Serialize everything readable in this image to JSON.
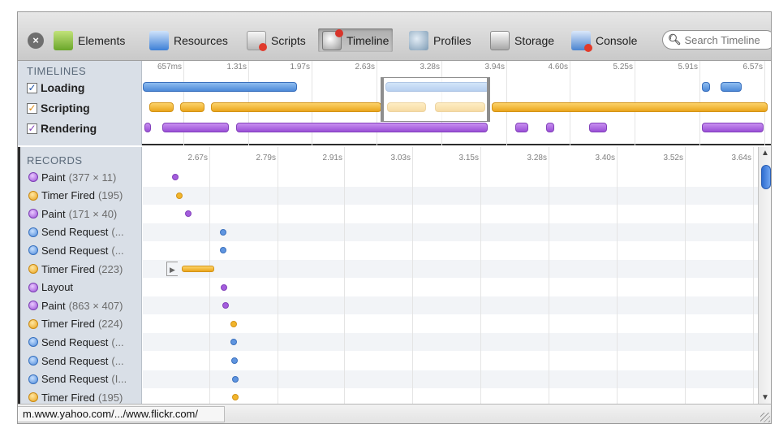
{
  "toolbar": {
    "tabs": [
      {
        "label": "Elements",
        "icon": "elements-icon"
      },
      {
        "label": "Resources",
        "icon": "resources-icon"
      },
      {
        "label": "Scripts",
        "icon": "scripts-icon"
      },
      {
        "label": "Timeline",
        "icon": "timeline-icon",
        "active": true
      },
      {
        "label": "Profiles",
        "icon": "profiles-icon"
      },
      {
        "label": "Storage",
        "icon": "storage-icon"
      },
      {
        "label": "Console",
        "icon": "console-icon"
      }
    ],
    "search_placeholder": "Search Timeline"
  },
  "timelines": {
    "header": "TIMELINES",
    "ticks": [
      "657ms",
      "1.31s",
      "1.97s",
      "2.63s",
      "3.28s",
      "3.94s",
      "4.60s",
      "5.25s",
      "5.91s",
      "6.57s"
    ],
    "categories": [
      {
        "label": "Loading",
        "checked": true,
        "color": "#4d89d8"
      },
      {
        "label": "Scripting",
        "checked": true,
        "color": "#eaa51c"
      },
      {
        "label": "Rendering",
        "checked": true,
        "color": "#9a4fd6"
      }
    ]
  },
  "records": {
    "header": "RECORDS",
    "ticks": [
      "2.67s",
      "2.79s",
      "2.91s",
      "3.03s",
      "3.15s",
      "3.28s",
      "3.40s",
      "3.52s",
      "3.64s"
    ],
    "rows": [
      {
        "type": "Paint",
        "detail": "(377 × 11)",
        "color": "purple"
      },
      {
        "type": "Timer Fired",
        "detail": "(195)",
        "color": "yellow"
      },
      {
        "type": "Paint",
        "detail": "(171 × 40)",
        "color": "purple"
      },
      {
        "type": "Send Request",
        "detail": "(...",
        "color": "blue"
      },
      {
        "type": "Send Request",
        "detail": "(...",
        "color": "blue"
      },
      {
        "type": "Timer Fired",
        "detail": "(223)",
        "color": "yellow"
      },
      {
        "type": "Layout",
        "detail": "",
        "color": "purple"
      },
      {
        "type": "Paint",
        "detail": "(863 × 407)",
        "color": "purple"
      },
      {
        "type": "Timer Fired",
        "detail": "(224)",
        "color": "yellow"
      },
      {
        "type": "Send Request",
        "detail": "(...",
        "color": "blue"
      },
      {
        "type": "Send Request",
        "detail": "(...",
        "color": "blue"
      },
      {
        "type": "Send Request",
        "detail": "(I...",
        "color": "blue"
      },
      {
        "type": "Timer Fired",
        "detail": "(195)",
        "color": "yellow"
      }
    ]
  },
  "status": {
    "url": "m.www.yahoo.com/.../www.flickr.com/"
  }
}
